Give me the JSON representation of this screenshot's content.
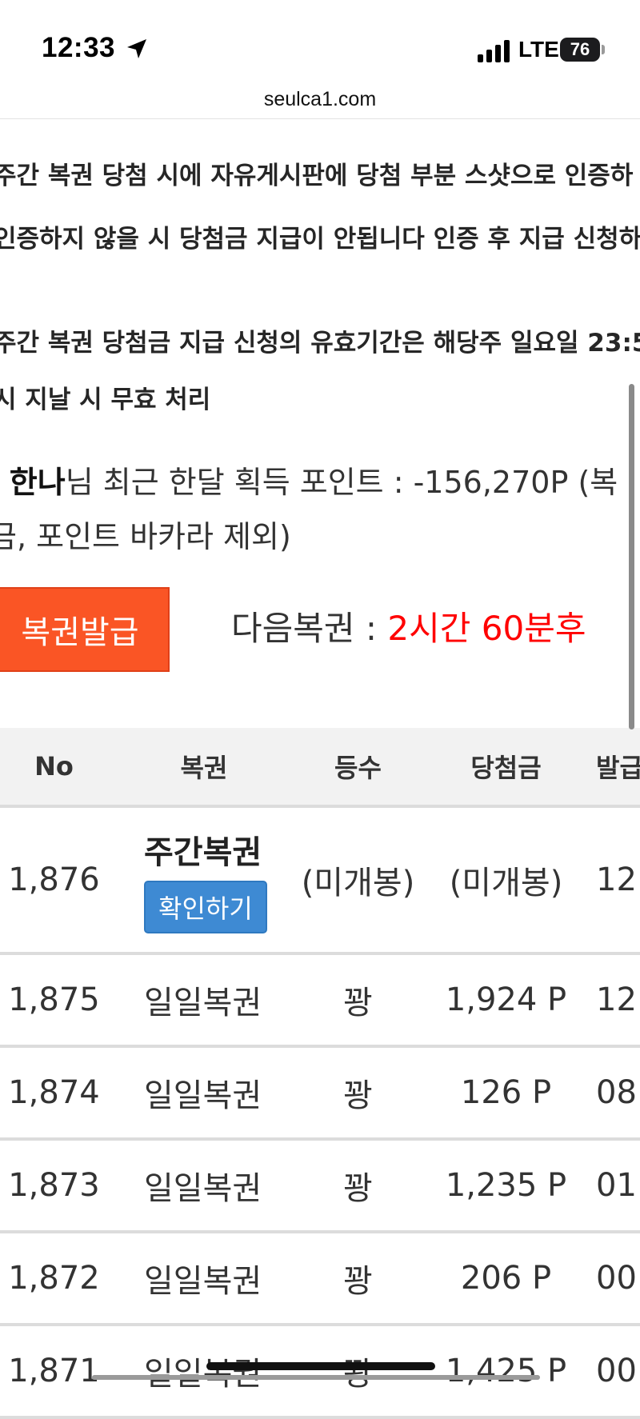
{
  "status_bar": {
    "time": "12:33",
    "network": "LTE",
    "battery": "76"
  },
  "browser": {
    "url": "seulca1.com"
  },
  "notices": [
    "주간 복권 당첨 시에 자유게시판에 당첨 부분 스샷으로 인증하",
    "인증하지 않을 시 당첨금 지급이 안됩니다 인증 후 지급 신청하",
    "주간 복권 당첨금 지급 신청의 유효기간은 해당주 일요일 23:5",
    "시 지날 시 무효 처리"
  ],
  "points_info": {
    "prefix": "- ",
    "username": "한나",
    "line1_rest": "님 최근 한달 획득 포인트 : -156,270P (복",
    "line2": "금, 포인트 바카라 제외)"
  },
  "issue": {
    "button_label": "복권발급",
    "next_label": "다음복권 : ",
    "next_value": "2시간 60분후"
  },
  "table": {
    "headers": {
      "no": "No",
      "type": "복권",
      "rank": "등수",
      "prize": "당첨금",
      "date": "발급"
    },
    "first_row": {
      "no": "1,876",
      "type": "주간복권",
      "check_label": "확인하기",
      "rank": "(미개봉)",
      "prize": "(미개봉)",
      "date": "12:"
    },
    "rows": [
      {
        "no": "1,875",
        "type": "일일복권",
        "rank": "꽝",
        "prize": "1,924 P",
        "date": "12:"
      },
      {
        "no": "1,874",
        "type": "일일복권",
        "rank": "꽝",
        "prize": "126 P",
        "date": "08"
      },
      {
        "no": "1,873",
        "type": "일일복권",
        "rank": "꽝",
        "prize": "1,235 P",
        "date": "01:"
      },
      {
        "no": "1,872",
        "type": "일일복권",
        "rank": "꽝",
        "prize": "206 P",
        "date": "00"
      },
      {
        "no": "1,871",
        "type": "일일복권",
        "rank": "꽝",
        "prize": "1,425 P",
        "date": "00"
      }
    ]
  }
}
